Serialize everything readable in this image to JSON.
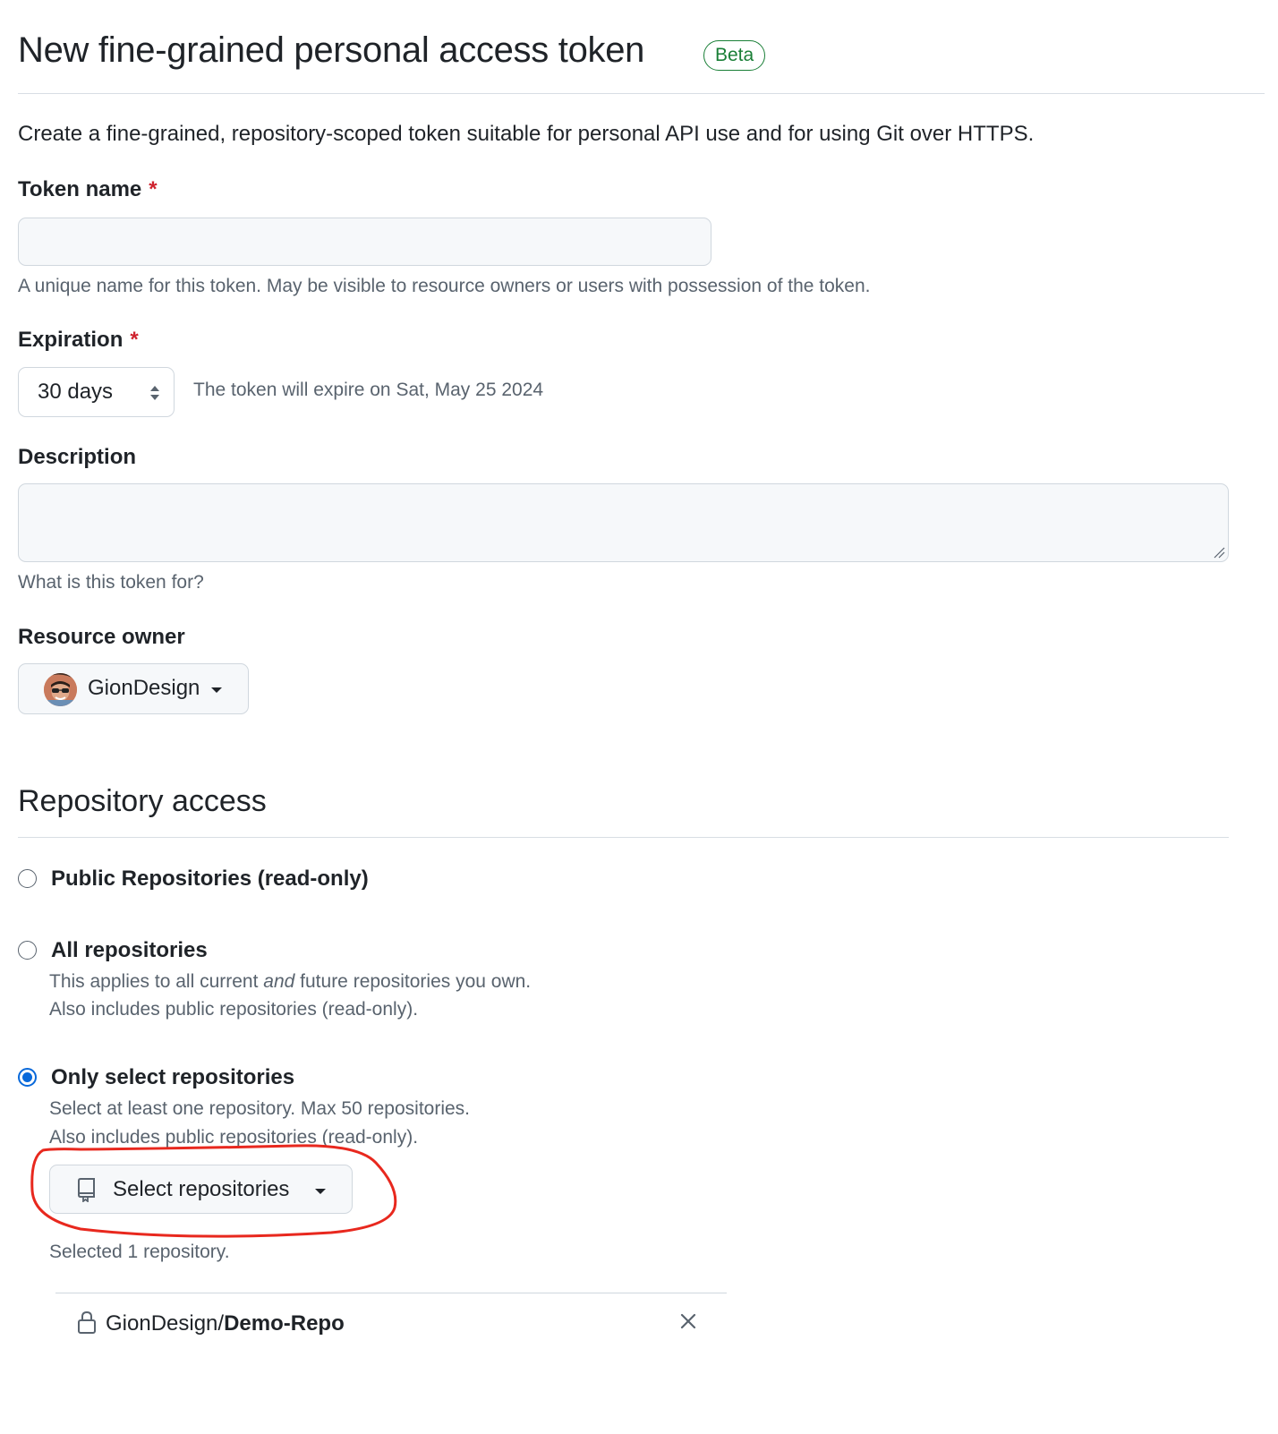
{
  "header": {
    "title": "New fine-grained personal access token",
    "badge": "Beta"
  },
  "intro": "Create a fine-grained, repository-scoped token suitable for personal API use and for using Git over HTTPS.",
  "token_name": {
    "label": "Token name",
    "required_mark": "*",
    "value": "",
    "hint": "A unique name for this token. May be visible to resource owners or users with possession of the token."
  },
  "expiration": {
    "label": "Expiration",
    "required_mark": "*",
    "selected": "30 days",
    "note": "The token will expire on Sat, May 25 2024"
  },
  "description": {
    "label": "Description",
    "value": "",
    "hint": "What is this token for?"
  },
  "resource_owner": {
    "label": "Resource owner",
    "selected": "GionDesign"
  },
  "repository_access": {
    "title": "Repository access",
    "options": [
      {
        "label": "Public Repositories (read-only)",
        "checked": false
      },
      {
        "label": "All repositories",
        "desc_pre": "This applies to all current ",
        "desc_em": "and",
        "desc_post": " future repositories you own.",
        "desc_line2": "Also includes public repositories (read-only).",
        "checked": false
      },
      {
        "label": "Only select repositories",
        "desc_line1": "Select at least one repository. Max 50 repositories.",
        "desc_line2": "Also includes public repositories (read-only).",
        "checked": true
      }
    ],
    "select_button": "Select repositories",
    "selected_count": "Selected 1 repository.",
    "repos": [
      {
        "owner": "GionDesign/",
        "name": "Demo-Repo",
        "icon": "lock-icon"
      }
    ]
  },
  "colors": {
    "accent": "#0969da",
    "success": "#1a7f37",
    "danger": "#cf222e",
    "annotation": "#e8281e"
  }
}
